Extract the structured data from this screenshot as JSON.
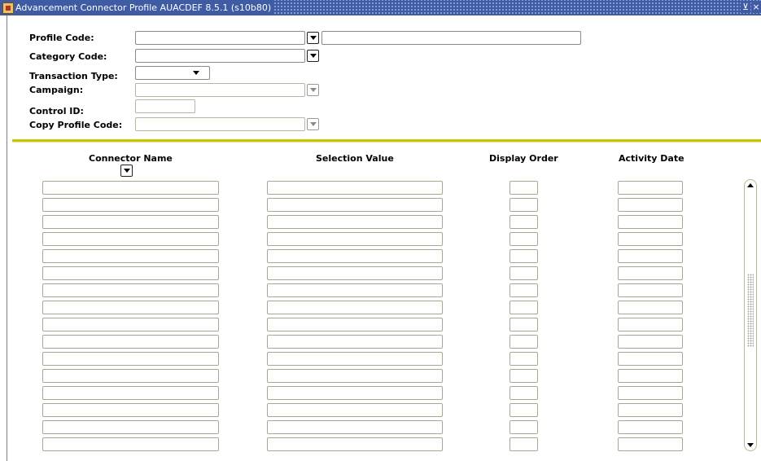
{
  "window": {
    "title": "Advancement Connector Profile  AUACDEF  8.5.1  (s10b80)",
    "minimize_glyph": "⊻",
    "close_glyph": "×"
  },
  "key_block": {
    "profile_code_label": "Profile Code:",
    "category_code_label": "Category Code:",
    "transaction_type_label": "Transaction Type:",
    "campaign_label": "Campaign:",
    "control_id_label": "Control ID:",
    "copy_profile_code_label": "Copy Profile Code:",
    "profile_code_value": "",
    "profile_code_desc": "",
    "category_code_value": "",
    "transaction_type_value": "",
    "campaign_value": "",
    "control_id_value": "",
    "copy_profile_code_value": ""
  },
  "grid": {
    "columns": [
      "Connector Name",
      "Selection Value",
      "Display Order",
      "Activity Date"
    ],
    "row_count": 16
  },
  "colors": {
    "title_bar": "#3f5ba4",
    "divider": "#c8c400"
  },
  "icons": [
    "app-icon",
    "dropdown-arrow-icon",
    "scroll-up-icon",
    "scroll-down-icon"
  ]
}
